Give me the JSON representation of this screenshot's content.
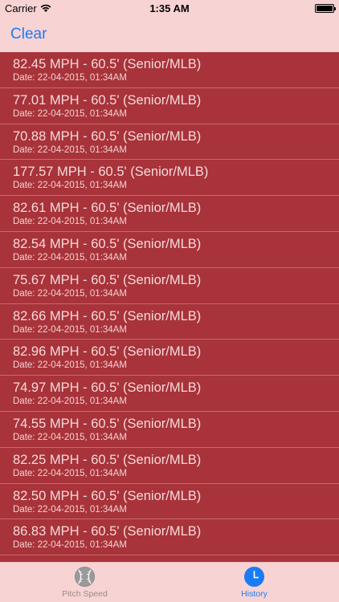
{
  "status_bar": {
    "carrier": "Carrier",
    "time": "1:35 AM"
  },
  "nav": {
    "clear_label": "Clear"
  },
  "history": [
    {
      "speed": "82.45 MPH - 60.5' (Senior/MLB)",
      "date": "Date: 22-04-2015, 01:34AM"
    },
    {
      "speed": "77.01 MPH - 60.5' (Senior/MLB)",
      "date": "Date: 22-04-2015, 01:34AM"
    },
    {
      "speed": "70.88 MPH - 60.5' (Senior/MLB)",
      "date": "Date: 22-04-2015, 01:34AM"
    },
    {
      "speed": "177.57 MPH - 60.5' (Senior/MLB)",
      "date": "Date: 22-04-2015, 01:34AM"
    },
    {
      "speed": "82.61 MPH - 60.5' (Senior/MLB)",
      "date": "Date: 22-04-2015, 01:34AM"
    },
    {
      "speed": "82.54 MPH - 60.5' (Senior/MLB)",
      "date": "Date: 22-04-2015, 01:34AM"
    },
    {
      "speed": "75.67 MPH - 60.5' (Senior/MLB)",
      "date": "Date: 22-04-2015, 01:34AM"
    },
    {
      "speed": "82.66 MPH - 60.5' (Senior/MLB)",
      "date": "Date: 22-04-2015, 01:34AM"
    },
    {
      "speed": "82.96 MPH - 60.5' (Senior/MLB)",
      "date": "Date: 22-04-2015, 01:34AM"
    },
    {
      "speed": "74.97 MPH - 60.5' (Senior/MLB)",
      "date": "Date: 22-04-2015, 01:34AM"
    },
    {
      "speed": "74.55 MPH - 60.5' (Senior/MLB)",
      "date": "Date: 22-04-2015, 01:34AM"
    },
    {
      "speed": "82.25 MPH - 60.5' (Senior/MLB)",
      "date": "Date: 22-04-2015, 01:34AM"
    },
    {
      "speed": "82.50 MPH - 60.5' (Senior/MLB)",
      "date": "Date: 22-04-2015, 01:34AM"
    },
    {
      "speed": "86.83 MPH - 60.5' (Senior/MLB)",
      "date": "Date: 22-04-2015, 01:34AM"
    }
  ],
  "tabs": [
    {
      "label": "Pitch Speed",
      "icon": "baseball-icon",
      "active": false
    },
    {
      "label": "History",
      "icon": "clock-icon",
      "active": true
    }
  ],
  "colors": {
    "list_background": "#a8333a",
    "bar_background": "#f8d3d4",
    "accent": "#1a7cf5"
  }
}
